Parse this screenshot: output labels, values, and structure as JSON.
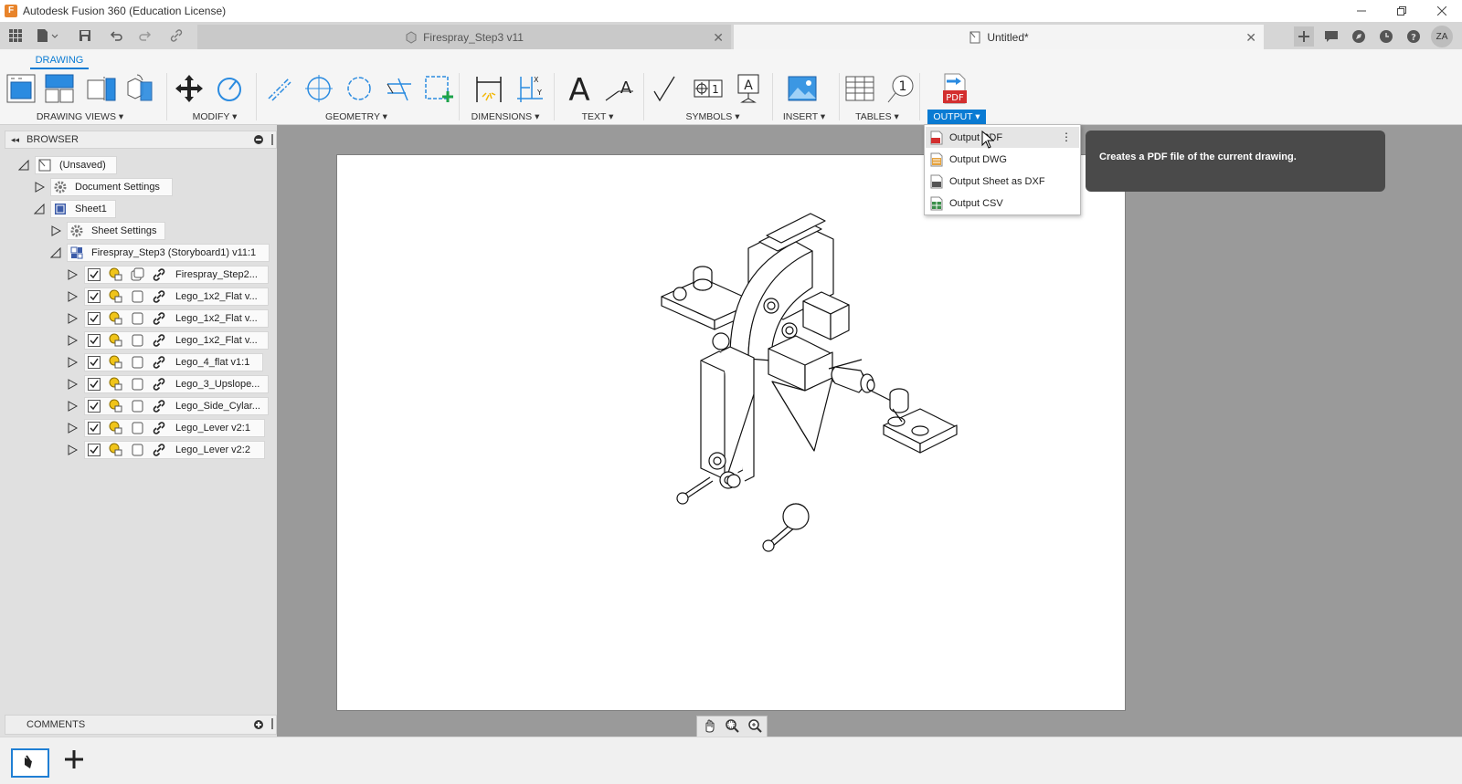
{
  "window": {
    "title": "Autodesk Fusion 360 (Education License)",
    "app_letter": "F"
  },
  "tabs": [
    {
      "label": "Firespray_Step3 v11",
      "active": false
    },
    {
      "label": "Untitled*",
      "active": true
    }
  ],
  "user": {
    "initials": "ZA"
  },
  "ribbon": {
    "workspace_tab": "DRAWING",
    "groups": {
      "drawing_views": "DRAWING VIEWS ▾",
      "modify": "MODIFY ▾",
      "geometry": "GEOMETRY ▾",
      "dimensions": "DIMENSIONS ▾",
      "text": "TEXT ▾",
      "symbols": "SYMBOLS ▾",
      "insert": "INSERT ▾",
      "tables": "TABLES ▾",
      "output": "OUTPUT ▾"
    },
    "pdf_badge": "PDF"
  },
  "browser": {
    "title": "BROWSER",
    "root": "(Unsaved)",
    "document_settings": "Document Settings",
    "sheet": "Sheet1",
    "sheet_settings": "Sheet Settings",
    "view": "Firespray_Step3 (Storyboard1) v11:1",
    "components": [
      "Firespray_Step2...",
      "Lego_1x2_Flat v...",
      "Lego_1x2_Flat v...",
      "Lego_1x2_Flat v...",
      "Lego_4_flat v1:1",
      "Lego_3_Upslope...",
      "Lego_Side_Cylar...",
      "Lego_Lever v2:1",
      "Lego_Lever v2:2"
    ]
  },
  "comments": {
    "title": "COMMENTS"
  },
  "output_menu": {
    "items": [
      {
        "label": "Output PDF",
        "icon": "pdf-file-icon"
      },
      {
        "label": "Output DWG",
        "icon": "dwg-file-icon"
      },
      {
        "label": "Output Sheet as DXF",
        "icon": "dxf-file-icon"
      },
      {
        "label": "Output CSV",
        "icon": "csv-file-icon"
      }
    ],
    "tooltip": "Creates a PDF file of the current drawing."
  },
  "colors": {
    "accent": "#0a7bd3",
    "canvas": "#9a9a9a",
    "pdf_red": "#d32f2f",
    "lock_yellow": "#f0c419"
  }
}
